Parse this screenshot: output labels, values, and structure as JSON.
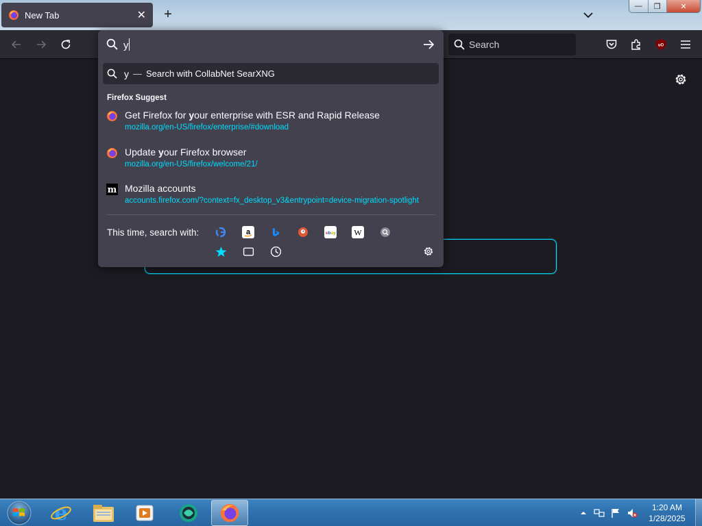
{
  "tab": {
    "title": "New Tab",
    "close_glyph": "✕"
  },
  "window": {
    "minimize_glyph": "—",
    "restore_glyph": "❐",
    "close_glyph": "✕",
    "new_tab_glyph": "+"
  },
  "navbar": {
    "search_placeholder": "Search"
  },
  "urlbar": {
    "input_value": "y",
    "heuristic": {
      "query": "y",
      "separator": "—",
      "label": "Search with CollabNet SearXNG"
    },
    "group_label": "Firefox Suggest",
    "suggestions": [
      {
        "title_prefix": "Get Firefox for ",
        "title_match": "y",
        "title_suffix": "our enterprise with ESR and Rapid Release",
        "url": "mozilla.org/en-US/firefox/enterprise/#download",
        "icon": "firefox-icon"
      },
      {
        "title_prefix": "Update ",
        "title_match": "y",
        "title_suffix": "our Firefox browser",
        "url": "mozilla.org/en-US/firefox/welcome/21/",
        "icon": "firefox-icon"
      },
      {
        "title_prefix": "Mozilla accounts",
        "title_match": "",
        "title_suffix": "",
        "url": "accounts.firefox.com/?context=fx_desktop_v3&entrypoint=device-migration-spotlight",
        "icon": "mozilla-m-icon"
      }
    ],
    "oneoff_label": "This time, search with:",
    "engines": [
      "google-icon",
      "amazon-icon",
      "bing-icon",
      "duckduckgo-icon",
      "ebay-icon",
      "wikipedia-icon",
      "searxng-icon",
      "bookmarks-icon",
      "tabs-icon",
      "history-icon"
    ]
  },
  "taskbar": {
    "time": "1:20 AM",
    "date": "1/28/2025",
    "apps": [
      "internet-explorer-icon",
      "windows-explorer-icon",
      "media-player-icon",
      "app-icon",
      "firefox-icon"
    ]
  },
  "colors": {
    "accent": "#00ddff",
    "panel": "#42414d",
    "toolbar": "#2b2a33",
    "page": "#1c1b22"
  }
}
